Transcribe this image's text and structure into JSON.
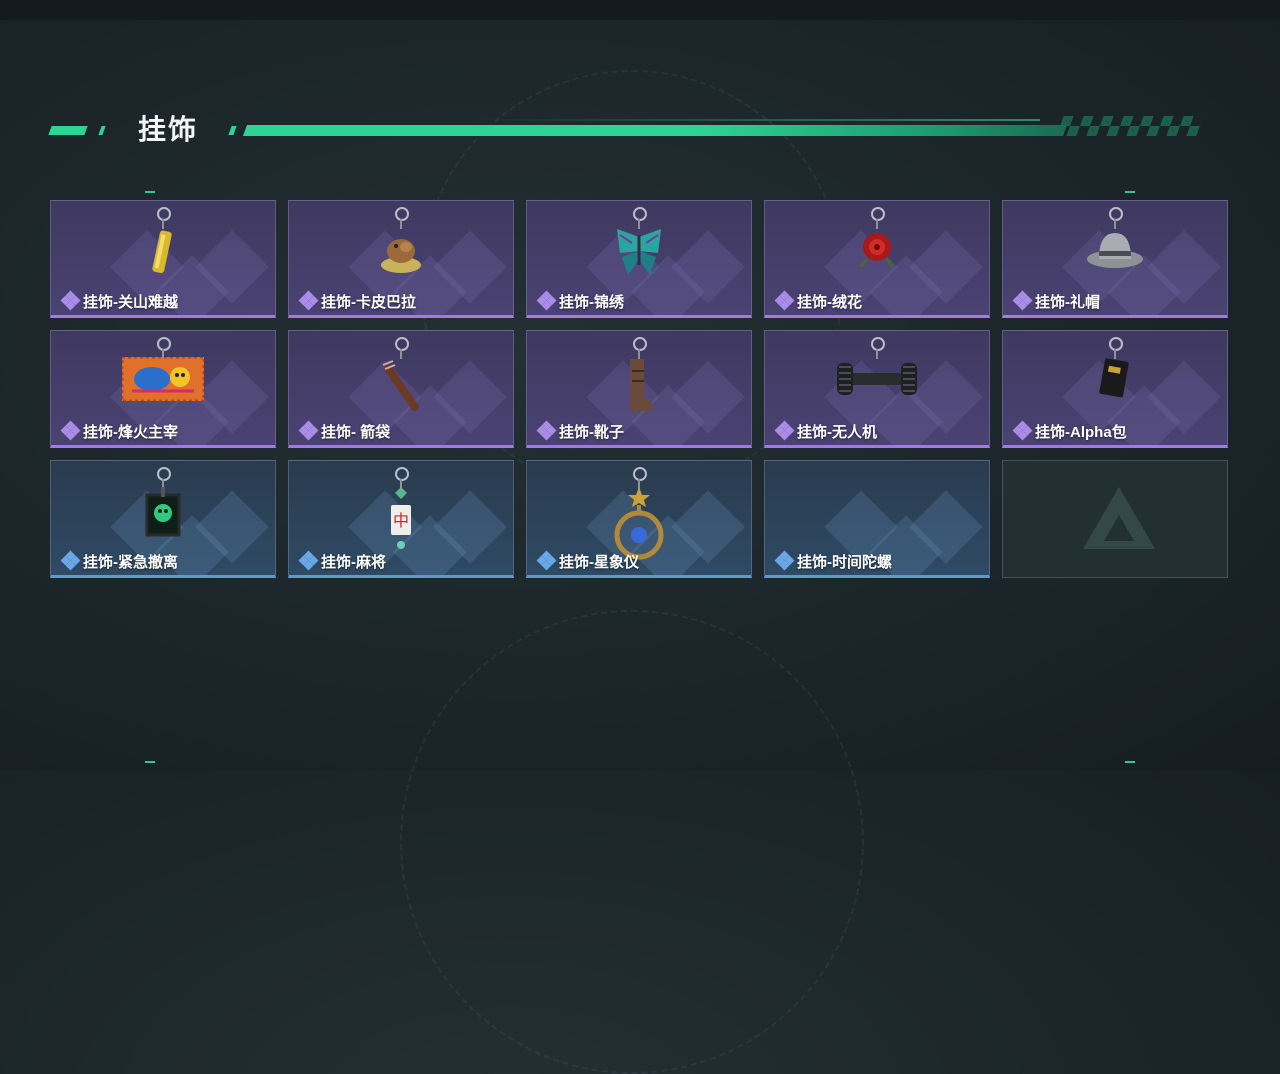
{
  "section": {
    "title": "挂饰"
  },
  "items": [
    {
      "name": "挂饰-关山难越",
      "rarity": "purple",
      "icon": "gold-cylinder-charm-icon"
    },
    {
      "name": "挂饰-卡皮巴拉",
      "rarity": "purple",
      "icon": "capybara-charm-icon"
    },
    {
      "name": "挂饰-锦绣",
      "rarity": "purple",
      "icon": "butterfly-charm-icon"
    },
    {
      "name": "挂饰-绒花",
      "rarity": "purple",
      "icon": "rose-charm-icon"
    },
    {
      "name": "挂饰-礼帽",
      "rarity": "purple",
      "icon": "hat-charm-icon"
    },
    {
      "name": "挂饰-烽火主宰",
      "rarity": "purple",
      "icon": "graffiti-banner-charm-icon"
    },
    {
      "name": "挂饰- 箭袋",
      "rarity": "purple",
      "icon": "quiver-charm-icon"
    },
    {
      "name": "挂饰-靴子",
      "rarity": "purple",
      "icon": "boot-charm-icon"
    },
    {
      "name": "挂饰-无人机",
      "rarity": "purple",
      "icon": "drone-charm-icon"
    },
    {
      "name": "挂饰-Alpha包",
      "rarity": "purple",
      "icon": "alpha-pack-charm-icon"
    },
    {
      "name": "挂饰-紧急撤离",
      "rarity": "blue",
      "icon": "emergency-exit-charm-icon"
    },
    {
      "name": "挂饰-麻将",
      "rarity": "blue",
      "icon": "mahjong-tile-charm-icon"
    },
    {
      "name": "挂饰-星象仪",
      "rarity": "blue",
      "icon": "astrolabe-charm-icon"
    },
    {
      "name": "挂饰-时间陀螺",
      "rarity": "blue",
      "icon": ""
    },
    {
      "name": "",
      "rarity": "empty",
      "icon": "game-logo-placeholder-icon"
    }
  ],
  "colors": {
    "accent": "#2fd394",
    "purple": "#a07be0",
    "blue": "#5a9ad6"
  }
}
